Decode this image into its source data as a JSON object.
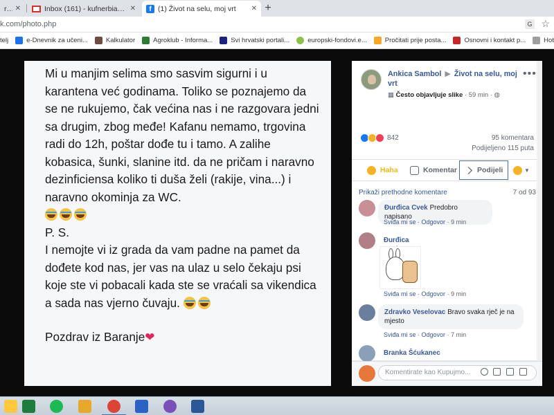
{
  "browser": {
    "tabs": [
      {
        "title": "r@y",
        "active": false
      },
      {
        "title": "Inbox (161) - kufnerbianka@gm...",
        "active": false
      },
      {
        "title": "(1) Život na selu, moj vrt",
        "active": true
      }
    ],
    "new_tab_label": "+",
    "url": "k.com/photo.php",
    "bookmarks": [
      {
        "label": "telj",
        "icon_color": "#e0e0e0"
      },
      {
        "label": "e-Dnevnik za učeni...",
        "icon_color": "#1a73e8"
      },
      {
        "label": "Kalkulator",
        "icon_color": "#6d4c41"
      },
      {
        "label": "Agroklub - Informa...",
        "icon_color": "#2e7d32"
      },
      {
        "label": "Svi hrvatski portali...",
        "icon_color": "#1a237e"
      },
      {
        "label": "europski-fondovi.e...",
        "icon_color": "#8bc34a"
      },
      {
        "label": "Pročitati prije posta...",
        "icon_color": "#f9a825"
      },
      {
        "label": "Osnovni i kontakt p...",
        "icon_color": "#c62828"
      },
      {
        "label": "Hotelijersko-tu",
        "icon_color": "#9e9e9e"
      }
    ]
  },
  "post_image": {
    "paragraphs": [
      "Mi u manjim selima smo sasvim sigurni i u karantena već godinama. Toliko se poznajemo da se ne rukujemo, čak većina nas i ne razgovara jedni sa drugim, zbog međe! Kafanu nemamo, trgovina radi do 12h, poštar dođe tu i tamo. A zalihe kobasica, šunki, slanine itd. da ne pričam i naravno dezinficiensa koliko ti duša želi (rakije, vina...) i naravno okominja za WC."
    ],
    "ps": "P. S.",
    "ps_text": "I nemojte vi iz grada da vam padne na pamet da dođete kod nas, jer vas na ulaz u selo čekaju psi koje ste vi pobacali kada ste se vraćali sa vikendica a sada nas vjerno čuvaju.",
    "signoff": "Pozdrav iz Baranje",
    "heart": "❤"
  },
  "panel": {
    "author": "Ankica Sambol",
    "arrow": "▶",
    "group": "Život na selu, moj vrt",
    "badge": "Često objavljuje slike",
    "time": "59 min",
    "more_label": "•••",
    "reactions_count": "842",
    "comments_count": "95 komentara",
    "shares_count": "Podijeljeno 115 puta",
    "actions": {
      "haha": "Haha",
      "comment": "Komentar",
      "share": "Podijeli",
      "caret": "▼"
    },
    "prev_comments": "Prikaži prethodne komentare",
    "comments_page": "7 od 93",
    "comments": [
      {
        "name": "Đurđica Cvek",
        "text": "Predobro napisano",
        "like": "Sviđa mi se",
        "reply": "Odgovor",
        "time": "9 min"
      },
      {
        "name": "Đurđica Cvek",
        "text": "",
        "like": "Sviđa mi se",
        "reply": "Odgovor",
        "time": "9 min"
      },
      {
        "name": "Zdravko Veselovac",
        "text": "Bravo svaka rječ je na mjesto",
        "like": "Sviđa mi se",
        "reply": "Odgovor",
        "time": "7 min"
      },
      {
        "name": "Branka Šćukanec",
        "text": ""
      }
    ],
    "composer_placeholder": "Komentirate kao Kupujmo...",
    "sep": "·"
  }
}
